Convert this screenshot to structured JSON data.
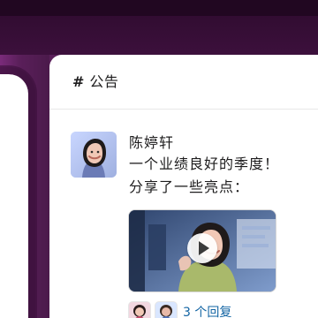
{
  "channel": {
    "prefix": "#",
    "name": "公告"
  },
  "message": {
    "author": "陈婷轩",
    "lines": [
      "一个业绩良好的季度！",
      "分享了一些亮点："
    ],
    "video": {
      "play_icon": "play-icon"
    },
    "thread": {
      "replies_text": "3 个回复"
    }
  },
  "colors": {
    "sidebar_purple": "#5a1f5a",
    "topbar_aubergine": "#2d0b2d",
    "link_blue": "#1264a3"
  }
}
